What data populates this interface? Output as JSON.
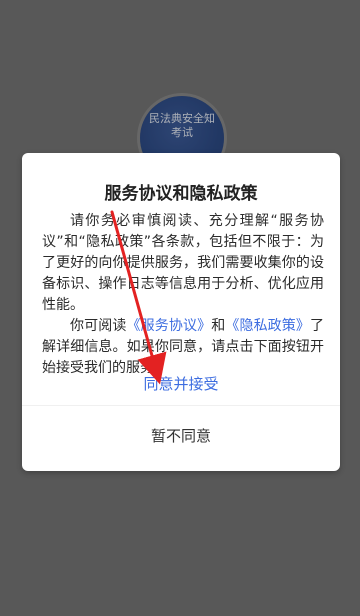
{
  "background": {
    "logo_text": "民法典安全知\n考试"
  },
  "dialog": {
    "title": "服务协议和隐私政策",
    "body_part1": "请你务必审慎阅读、充分理解“服务协议”和“隐私政策”各条款，包括但不限于：为了更好的向你提供服务，我们需要收集你的设备标识、操作日志等信息用于分析、优化应用性能。",
    "body_part2_prefix": "你可阅读",
    "link_service": "《服务协议》",
    "and_text": "和",
    "link_privacy": "《隐私政策》",
    "body_part2_suffix": "了解详细信息。如果你同意，请点击下面按钮开始接受我们的服务。",
    "agree_label": "同意并接受",
    "disagree_label": "暂不同意"
  },
  "annotation": {
    "color": "#e32222"
  }
}
